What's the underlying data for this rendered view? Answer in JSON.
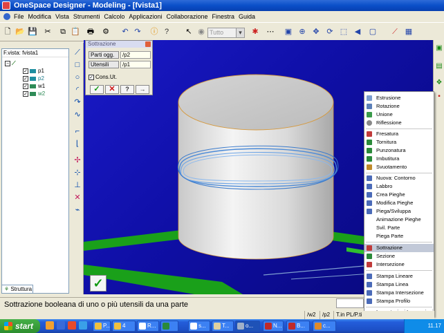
{
  "window": {
    "title": "OneSpace Designer - Modeling - [fvista1]"
  },
  "menu": [
    "File",
    "Modifica",
    "Vista",
    "Strumenti",
    "Calcolo",
    "Applicazioni",
    "Collaborazione",
    "Finestra",
    "Guida"
  ],
  "toolbar": {
    "select_value": "Tutto"
  },
  "tree": {
    "title": "F.vista: fvista1",
    "items": [
      {
        "label": "p1",
        "checked": true,
        "color": "#1e8ea0"
      },
      {
        "label": "p2",
        "checked": true,
        "color": "#1e8ea0"
      },
      {
        "label": "w1",
        "checked": true,
        "color": "#2e8b57"
      },
      {
        "label": "w2",
        "checked": true,
        "color": "#2e8b57"
      }
    ],
    "tab": "Struttura"
  },
  "dialog": {
    "title": "Sottrazione",
    "parts_label": "Parti ogg.",
    "parts_value": "/p2",
    "tools_label": "Utensili",
    "tools_value": "/p1",
    "cons_label": "Cons.Ut.",
    "cons_checked": true
  },
  "context_menu": {
    "groups": [
      [
        "Estrusione",
        "Rotazione",
        "Unione",
        "Riflessione"
      ],
      [
        "Fresatura",
        "Tornitura",
        "Punzonatura",
        "Imbutitura",
        "Svuotamento"
      ],
      [
        "Nuova: Contorno",
        "Labbro",
        "Crea Pieghe",
        "Modifica Pieghe",
        "Piega/Sviluppa",
        "Animazione Pieghe",
        "Svil. Parte",
        "Piega Parte"
      ],
      [
        "Sottrazione",
        "Sezione",
        "Intersezione"
      ],
      [
        "Stampa Lineare",
        "Stampa Linea",
        "Stampa Intersezione",
        "Stampa Profilo"
      ],
      [
        "Impostazioni Lavorazioni"
      ]
    ],
    "highlighted": "Sottrazione"
  },
  "status": {
    "message": "Sottrazione booleana di uno o più utensili da una parte",
    "part": "/w2",
    "workplane": "/p2",
    "tool": "T.in PL/P.ti"
  },
  "taskbar": {
    "start": "start",
    "tasks": [
      "P...",
      "4",
      "R...",
      "",
      "s...",
      "T...",
      "o...",
      "N...",
      "B...",
      "c..."
    ],
    "active_index": 6,
    "clock": "11.17"
  }
}
